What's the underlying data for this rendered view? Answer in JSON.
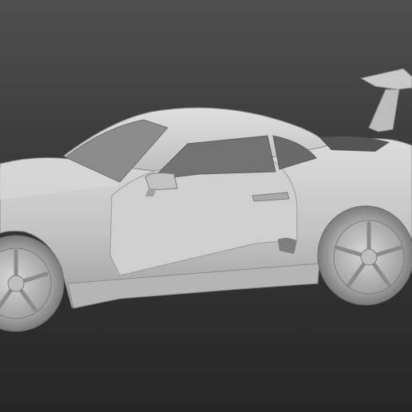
{
  "scene": {
    "kind": "3d-render",
    "background_top": "#4f4f4f",
    "background_bottom": "#262626",
    "model_color": "#c8c8c8",
    "shade_color": "#9a9a9a",
    "glass_color": "#6b6b6b"
  }
}
